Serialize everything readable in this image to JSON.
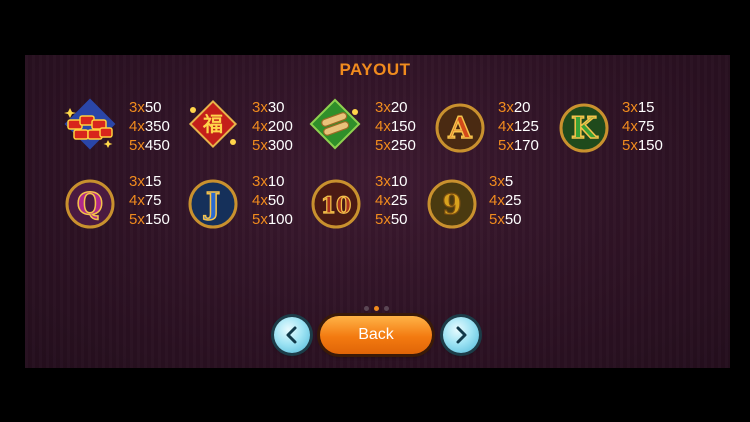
{
  "title": "PAYOUT",
  "symbols": [
    {
      "icon": "firecrackers-icon",
      "pays": [
        {
          "n": "3",
          "x": "x",
          "v": "50"
        },
        {
          "n": "4",
          "x": "x",
          "v": "350"
        },
        {
          "n": "5",
          "x": "x",
          "v": "450"
        }
      ]
    },
    {
      "icon": "fortune-tile-icon",
      "pays": [
        {
          "n": "3",
          "x": "x",
          "v": "30"
        },
        {
          "n": "4",
          "x": "x",
          "v": "200"
        },
        {
          "n": "5",
          "x": "x",
          "v": "300"
        }
      ]
    },
    {
      "icon": "scrolls-icon",
      "pays": [
        {
          "n": "3",
          "x": "x",
          "v": "20"
        },
        {
          "n": "4",
          "x": "x",
          "v": "150"
        },
        {
          "n": "5",
          "x": "x",
          "v": "250"
        }
      ]
    },
    {
      "icon": "letter-a-icon",
      "pays": [
        {
          "n": "3",
          "x": "x",
          "v": "20"
        },
        {
          "n": "4",
          "x": "x",
          "v": "125"
        },
        {
          "n": "5",
          "x": "x",
          "v": "170"
        }
      ]
    },
    {
      "icon": "letter-k-icon",
      "pays": [
        {
          "n": "3",
          "x": "x",
          "v": "15"
        },
        {
          "n": "4",
          "x": "x",
          "v": "75"
        },
        {
          "n": "5",
          "x": "x",
          "v": "150"
        }
      ]
    },
    {
      "icon": "letter-q-icon",
      "pays": [
        {
          "n": "3",
          "x": "x",
          "v": "15"
        },
        {
          "n": "4",
          "x": "x",
          "v": "75"
        },
        {
          "n": "5",
          "x": "x",
          "v": "150"
        }
      ]
    },
    {
      "icon": "letter-j-icon",
      "pays": [
        {
          "n": "3",
          "x": "x",
          "v": "10"
        },
        {
          "n": "4",
          "x": "x",
          "v": "50"
        },
        {
          "n": "5",
          "x": "x",
          "v": "100"
        }
      ]
    },
    {
      "icon": "number-10-icon",
      "pays": [
        {
          "n": "3",
          "x": "x",
          "v": "10"
        },
        {
          "n": "4",
          "x": "x",
          "v": "25"
        },
        {
          "n": "5",
          "x": "x",
          "v": "50"
        }
      ]
    },
    {
      "icon": "number-9-icon",
      "pays": [
        {
          "n": "3",
          "x": "x",
          "v": "5"
        },
        {
          "n": "4",
          "x": "x",
          "v": "25"
        },
        {
          "n": "5",
          "x": "x",
          "v": "50"
        }
      ]
    }
  ],
  "pager": {
    "pages": 3,
    "current": 2
  },
  "buttons": {
    "back_label": "Back",
    "prev_icon": "chevron-left-icon",
    "next_icon": "chevron-right-icon"
  },
  "colors": {
    "accent": "#f08b1e",
    "background": "#2d1224",
    "nav_button": "#9fe4f4"
  }
}
